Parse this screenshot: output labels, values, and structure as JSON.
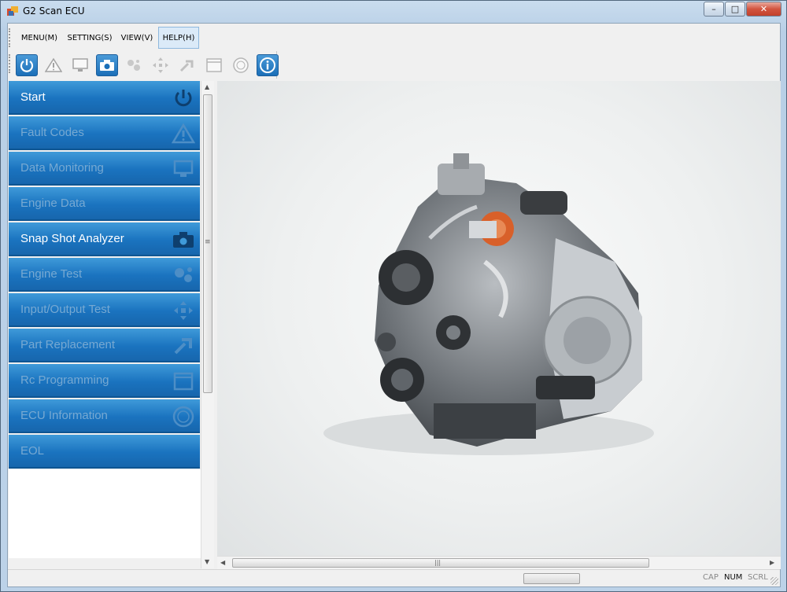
{
  "window": {
    "title": "G2 Scan ECU",
    "controls": {
      "minimize": "–",
      "maximize": "□",
      "close": "✕"
    }
  },
  "menu": [
    {
      "label": "MENU(M)",
      "active": false
    },
    {
      "label": "SETTING(S)",
      "active": false
    },
    {
      "label": "VIEW(V)",
      "active": false
    },
    {
      "label": "HELP(H)",
      "active": true
    }
  ],
  "toolbar": [
    {
      "icon": "power-icon",
      "enabled": true
    },
    {
      "icon": "warning-icon",
      "enabled": false
    },
    {
      "icon": "monitor-icon",
      "enabled": false
    },
    {
      "icon": "camera-icon",
      "enabled": true
    },
    {
      "icon": "engine-test-icon",
      "enabled": false
    },
    {
      "icon": "io-arrows-icon",
      "enabled": false
    },
    {
      "icon": "part-replace-icon",
      "enabled": false
    },
    {
      "icon": "rc-program-icon",
      "enabled": false
    },
    {
      "icon": "ecu-icon",
      "enabled": false
    },
    {
      "icon": "info-icon",
      "enabled": true
    }
  ],
  "sidebar": {
    "items": [
      {
        "label": "Start",
        "enabled": true,
        "icon": "power-icon"
      },
      {
        "label": "Fault Codes",
        "enabled": false,
        "icon": "warning-icon"
      },
      {
        "label": "Data Monitoring",
        "enabled": false,
        "icon": "monitor-icon"
      },
      {
        "label": "Engine Data",
        "enabled": false,
        "icon": ""
      },
      {
        "label": "Snap Shot Analyzer",
        "enabled": true,
        "icon": "camera-icon"
      },
      {
        "label": "Engine Test",
        "enabled": false,
        "icon": "engine-test-icon"
      },
      {
        "label": "Input/Output Test",
        "enabled": false,
        "icon": "io-arrows-icon"
      },
      {
        "label": "Part Replacement",
        "enabled": false,
        "icon": "part-replace-icon"
      },
      {
        "label": "Rc Programming",
        "enabled": false,
        "icon": "rc-program-icon"
      },
      {
        "label": "ECU Information",
        "enabled": false,
        "icon": "ecu-icon"
      },
      {
        "label": "EOL",
        "enabled": false,
        "icon": ""
      }
    ],
    "scroll_grip": "≡"
  },
  "main": {
    "image": "engine-image"
  },
  "hscroll": {
    "grip": "|||"
  },
  "status": {
    "cap": "CAP",
    "num": "NUM",
    "scrl": "SCRL"
  },
  "colors": {
    "nav_blue": "#1a73bf",
    "nav_disabled_text": "#77a9d2",
    "accent": "#1b6fb8"
  }
}
